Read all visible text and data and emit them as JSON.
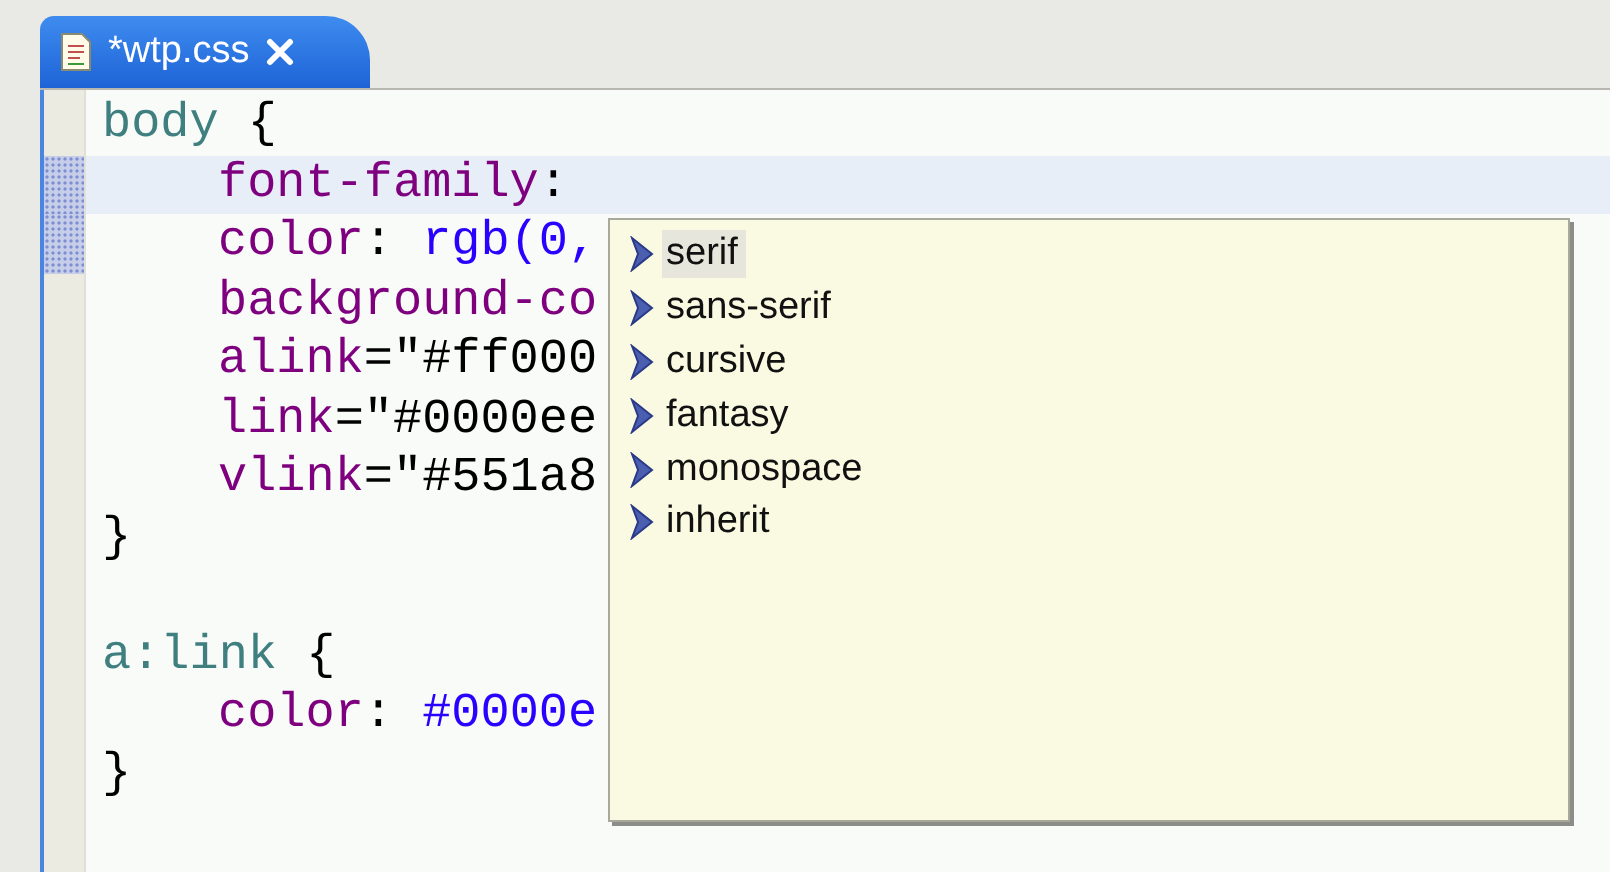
{
  "tab": {
    "title": "*wtp.css",
    "selected": true
  },
  "code_lines": [
    {
      "current": false,
      "marker": false,
      "indented": false,
      "tokens": [
        {
          "kind": "selector",
          "text": "body"
        },
        {
          "kind": "plain",
          "text": " {"
        }
      ]
    },
    {
      "current": true,
      "marker": true,
      "indented": true,
      "tokens": [
        {
          "kind": "property",
          "text": "font-family"
        },
        {
          "kind": "plain",
          "text": ":"
        }
      ]
    },
    {
      "current": false,
      "marker": true,
      "indented": true,
      "tokens": [
        {
          "kind": "property",
          "text": "color"
        },
        {
          "kind": "plain",
          "text": ": "
        },
        {
          "kind": "value",
          "text": "rgb(0,"
        }
      ]
    },
    {
      "current": false,
      "marker": false,
      "indented": true,
      "tokens": [
        {
          "kind": "property",
          "text": "background-co"
        }
      ]
    },
    {
      "current": false,
      "marker": false,
      "indented": true,
      "tokens": [
        {
          "kind": "property",
          "text": "alink"
        },
        {
          "kind": "plain",
          "text": "=\"#ff000"
        }
      ]
    },
    {
      "current": false,
      "marker": false,
      "indented": true,
      "tokens": [
        {
          "kind": "property",
          "text": "link"
        },
        {
          "kind": "plain",
          "text": "=\"#0000ee"
        }
      ]
    },
    {
      "current": false,
      "marker": false,
      "indented": true,
      "tokens": [
        {
          "kind": "property",
          "text": "vlink"
        },
        {
          "kind": "plain",
          "text": "=\"#551a8"
        }
      ]
    },
    {
      "current": false,
      "marker": false,
      "indented": false,
      "tokens": [
        {
          "kind": "plain",
          "text": "}"
        }
      ]
    },
    {
      "current": false,
      "marker": false
    },
    {
      "current": false,
      "marker": false,
      "indented": false,
      "tokens": [
        {
          "kind": "selector",
          "text": "a:link"
        },
        {
          "kind": "plain",
          "text": " {"
        }
      ]
    },
    {
      "current": false,
      "marker": false,
      "indented": true,
      "tokens": [
        {
          "kind": "property",
          "text": "color"
        },
        {
          "kind": "plain",
          "text": ": "
        },
        {
          "kind": "value",
          "text": "#0000e"
        }
      ]
    },
    {
      "current": false,
      "marker": false,
      "indented": false,
      "tokens": [
        {
          "kind": "plain",
          "text": "}"
        }
      ]
    }
  ],
  "completions": [
    {
      "label": "serif",
      "selected": true
    },
    {
      "label": "sans-serif",
      "selected": false
    },
    {
      "label": "cursive",
      "selected": false
    },
    {
      "label": "fantasy",
      "selected": false
    },
    {
      "label": "monospace",
      "selected": false
    },
    {
      "label": "inherit",
      "selected": false
    }
  ]
}
